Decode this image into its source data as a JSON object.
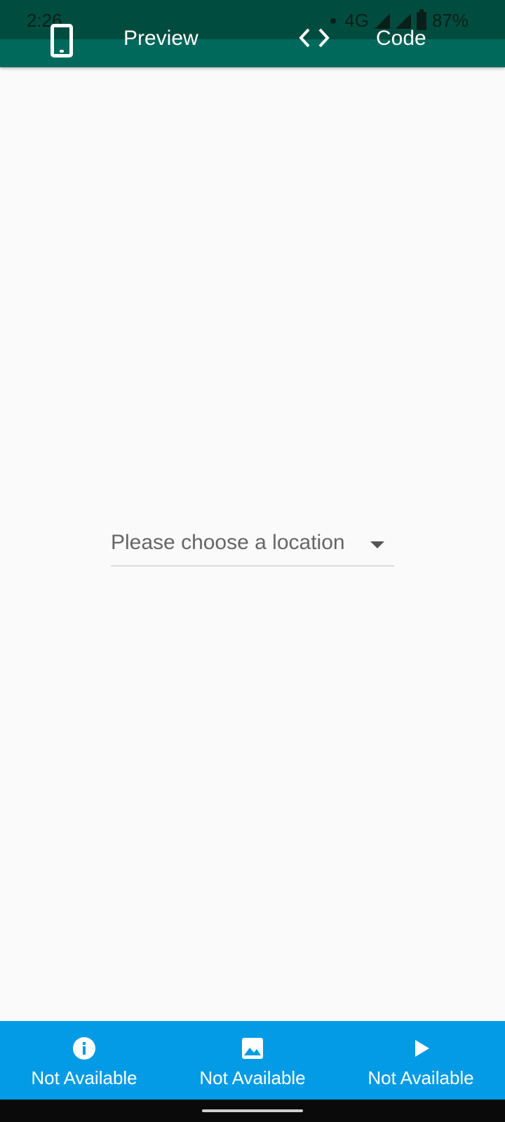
{
  "status_bar": {
    "time": "2:26",
    "network": "4G",
    "battery": "87%"
  },
  "app_bar": {
    "tabs": [
      {
        "label": "Preview",
        "icon": "phone-icon"
      },
      {
        "label": "Code",
        "icon": "code-icon"
      }
    ],
    "color": "#00695c"
  },
  "main": {
    "dropdown": {
      "placeholder": "Please choose a location",
      "icon": "arrow-drop-down-icon"
    }
  },
  "bottom_nav": {
    "color": "#039be5",
    "items": [
      {
        "label": "Not Available",
        "icon": "info-icon"
      },
      {
        "label": "Not Available",
        "icon": "image-icon"
      },
      {
        "label": "Not Available",
        "icon": "play-icon"
      }
    ]
  }
}
